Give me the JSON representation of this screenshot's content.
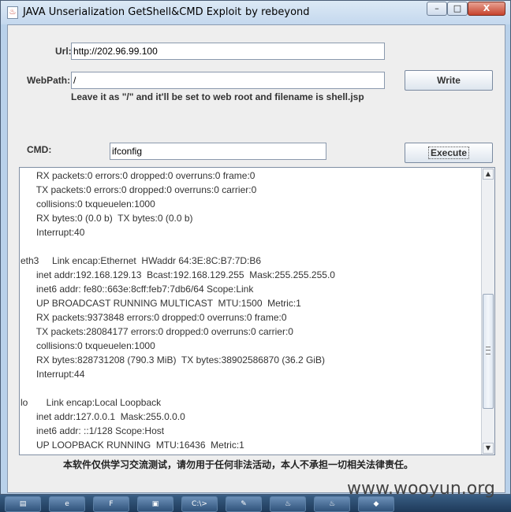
{
  "window": {
    "title": "JAVA Unserialization GetShell&CMD Exploit",
    "author": "by rebeyond",
    "controls": {
      "minimize": "–",
      "maximize": "□",
      "close": "X"
    }
  },
  "form": {
    "url_label": "Url:",
    "url_value": "http://202.96.99.100",
    "webpath_label": "WebPath:",
    "webpath_value": "/",
    "write_button": "Write",
    "hint": "Leave it as \"/\" and it'll be set to web root and filename is shell.jsp",
    "cmd_label": "CMD:",
    "cmd_value": "ifconfig",
    "execute_button": "Execute"
  },
  "output_lines": [
    "      RX packets:0 errors:0 dropped:0 overruns:0 frame:0",
    "      TX packets:0 errors:0 dropped:0 overruns:0 carrier:0",
    "      collisions:0 txqueuelen:1000",
    "      RX bytes:0 (0.0 b)  TX bytes:0 (0.0 b)",
    "      Interrupt:40",
    "",
    "eth3     Link encap:Ethernet  HWaddr 64:3E:8C:B7:7D:B6",
    "      inet addr:192.168.129.13  Bcast:192.168.129.255  Mask:255.255.255.0",
    "      inet6 addr: fe80::663e:8cff:feb7:7db6/64 Scope:Link",
    "      UP BROADCAST RUNNING MULTICAST  MTU:1500  Metric:1",
    "      RX packets:9373848 errors:0 dropped:0 overruns:0 frame:0",
    "      TX packets:28084177 errors:0 dropped:0 overruns:0 carrier:0",
    "      collisions:0 txqueuelen:1000",
    "      RX bytes:828731208 (790.3 MiB)  TX bytes:38902586870 (36.2 GiB)",
    "      Interrupt:44",
    "",
    "lo       Link encap:Local Loopback",
    "      inet addr:127.0.0.1  Mask:255.0.0.0",
    "      inet6 addr: ::1/128 Scope:Host",
    "      UP LOOPBACK RUNNING  MTU:16436  Metric:1"
  ],
  "scrollbar": {
    "up": "▲",
    "down": "▼"
  },
  "disclaimer": "本软件仅供学习交流测试，请勿用于任何非法活动，本人不承担一切相关法律责任。",
  "watermark": "www.wooyun.org",
  "taskbar": [
    {
      "icon": "folder-icon",
      "glyph": "▤"
    },
    {
      "icon": "browser-icon",
      "glyph": "e"
    },
    {
      "icon": "app-green-icon",
      "glyph": "F"
    },
    {
      "icon": "package-icon",
      "glyph": "▣"
    },
    {
      "icon": "terminal-icon",
      "glyph": "C:\\>"
    },
    {
      "icon": "editor-icon",
      "glyph": "✎"
    },
    {
      "icon": "java-icon",
      "glyph": "♨"
    },
    {
      "icon": "java-icon-2",
      "glyph": "♨"
    },
    {
      "icon": "app-icon",
      "glyph": "◆"
    }
  ]
}
